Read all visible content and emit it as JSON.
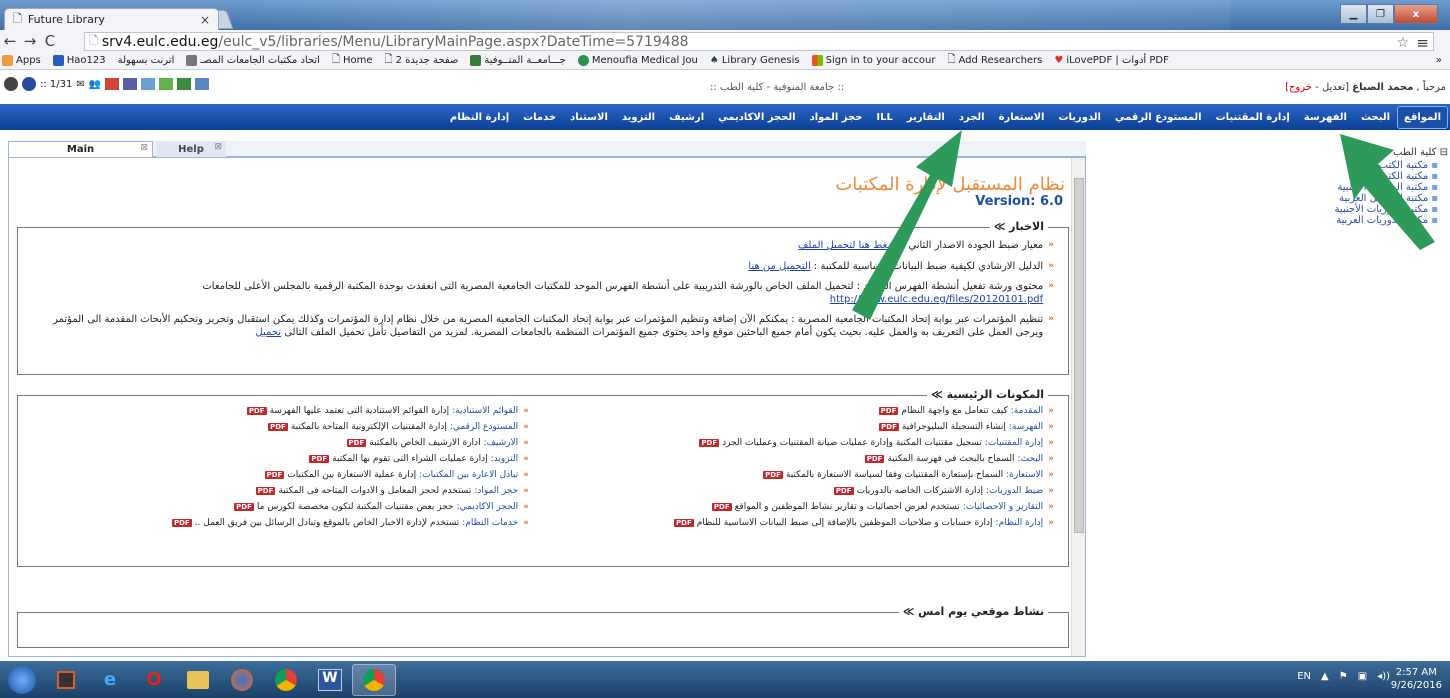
{
  "browser": {
    "tab_title": "Future Library",
    "tab_close": "×",
    "window_buttons": [
      "▁",
      "❐",
      "x"
    ],
    "nav": {
      "back": "←",
      "forward": "→",
      "reload": "C"
    },
    "url_host": "srv4.eulc.edu.eg",
    "url_path": "/eulc_v5/libraries/Menu/LibraryMainPage.aspx?DateTime=5719488",
    "star": "☆",
    "menu": "≡",
    "bookmarks": [
      "Apps",
      "Hao123",
      "اترنت بسهولة",
      "اتحاد مكتبات الجامعات المصـ",
      "Home",
      "صفحة جديدة 2",
      "جـــامعــة المنــوفية",
      "Menoufia Medical Jou",
      "Library Genesis",
      "Sign in to your accour",
      "Add Researchers",
      "iLovePDF | أدوات PDF",
      "»"
    ]
  },
  "status": {
    "left_text": ":: 1/31",
    "flag_colors": [
      "#d0453a",
      "#5c5ca8",
      "#6aa0d8",
      "#64b04a",
      "#3e8a3e",
      "#5a86c4"
    ],
    "center": ":: جامعة المنوفية - كلية الطب ::",
    "greeting": "مرحباً ,",
    "user": "محمد الصباغ",
    "edit": "[تعديل -",
    "logout": "خروج]"
  },
  "mainnav": [
    "المواقع",
    "البحث",
    "الفهرسة",
    "إدارة المقتنيات",
    "المستودع الرقمي",
    "الدوريات",
    "الاستعارة",
    "الجرد",
    "التقارير",
    "ILL",
    "حجز المواد",
    "الحجز الاكاديمي",
    "ارشيف",
    "التزويد",
    "الاستناد",
    "خدمات",
    "إدارة النظام"
  ],
  "panel_tabs": [
    {
      "label": "Main",
      "close": "⊠"
    },
    {
      "label": "Help",
      "close": "⊠"
    }
  ],
  "app_title": "نظام المستقبل لإدارة المكتبات",
  "version": "Version: 6.0",
  "news": {
    "legend": "الاخبار ≫",
    "items": [
      {
        "text": "معيار ضبط الجودة الاصدار الثاني :",
        "link": "اضغط هنا لتحميل الملف"
      },
      {
        "text": "الدليل الارشادي لكيفية ضبط البيانات الأساسية للمكتبة :",
        "link": "التحميل من هنا"
      },
      {
        "text": "محتوى ورشة تفعيل أنشطة الفهرس الموحد : لتحميل الملف الخاص بالورشة التدريبية على أنشطة الفهرس الموحد للمكتبات الجامعية المصرية التى انعقدت بوحدة المكتبة الرقمية بالمجلس الأعلى للجامعات",
        "link": "http://www.eulc.edu.eg/files/20120101.pdf"
      },
      {
        "text": "تنظيم المؤتمرات عبر بوابة إتحاد المكتبات الجامعية المصرية : يمكنكم الآن إضافة وتنظيم المؤتمرات عبر بوابة إتحاد المكتبات الجامعية المصرية من خلال نظام إدارة المؤتمرات وكذلك يمكن استقبال وتحرير وتحكيم الأبحاث المقدمة الى المؤتمر ويرجى العمل على التعريف به والعمل عليه. بحيث يكون أمام جميع الباحثين موقع واحد يحتوى جميع المؤتمرات المنظمة بالجامعات المصرية. لمزيد من التفاصيل تأمل تحميل الملف التالى",
        "link": "تحميل"
      }
    ]
  },
  "components": {
    "legend": "المكونات الرئيسية ≫",
    "pdf": "PDF",
    "items": [
      {
        "t": "المقدمة:",
        "d": "كيف تتعامل مع واجهة النظام"
      },
      {
        "t": "القوائم الاستنادية:",
        "d": "إدارة القوائم الاستنادية التى تعتمد عليها الفهرسة"
      },
      {
        "t": "الفهرسة:",
        "d": "إنشاء التسجيلة الببليوجرافية"
      },
      {
        "t": "المستودع الرقمي:",
        "d": "إدارة المقتنيات الإلكترونية المتاحة بالمكتبة"
      },
      {
        "t": "إدارة المقتنيات:",
        "d": "تسجيل مقتنيات المكتبة وإدارة عمليات صيانة المقتنيات وعمليات الجرد"
      },
      {
        "t": "الأرشيف:",
        "d": "ادارة الارشيف الخاص بالمكتبة"
      },
      {
        "t": "البحث:",
        "d": "السماح بالبحث فى فهرسة المكتبة"
      },
      {
        "t": "التزويد:",
        "d": "إدارة عمليات الشراء التى تقوم بها المكتبة"
      },
      {
        "t": "الاستعارة:",
        "d": "السماح بإستعارة المقتنيات وفقاً لسياسة الاستعارة بالمكتبة"
      },
      {
        "t": "تبادل الاعارة بين المكتبات:",
        "d": "إدارة عملية الاستعارة بين المكتبات"
      },
      {
        "t": "ضبط الدوريات:",
        "d": "إدارة الاشتركات الخاصه بالدوريات"
      },
      {
        "t": "حجز المواد:",
        "d": "تستخدم لحجز المعامل و الأدوات المتاحه فى المكتبة"
      },
      {
        "t": "التقارير و الاحصائيات:",
        "d": "تستخدم لعرض احصائيات و تقارير نشاط الموظفين و المواقع"
      },
      {
        "t": "الحجز الاكاديمي:",
        "d": "حجز بعض مقتنيات المكتبة لتكون مخصصة لكورس ما"
      },
      {
        "t": "إدارة النظام:",
        "d": "إدارة حسابات و صلاحيات الموظفين بالإضافة إلى ضبط البيانات الاساسية للنظام"
      },
      {
        "t": "خدمات النظام:",
        "d": "تستخدم لإدارة الاخبار الخاص بالموقع وتبادل الرسائل بين فريق العمل .."
      }
    ]
  },
  "activity": {
    "legend": "نشاط موقعي يوم امس ≫"
  },
  "tree": {
    "root": "⊟ كلية الطب",
    "items": [
      "مكتبة الكتب الاجنبية",
      "مكتبة الكتب العربية",
      "مكتبة الرسائل الأجنبية",
      "مكتبة الرسائل العربية",
      "مكتبة الدوريات الأجنبية",
      "مكتبة الدوريات العربية"
    ]
  },
  "taskbar": {
    "apps": [
      "start",
      "media",
      "ie",
      "opera",
      "explorer",
      "firefox",
      "chrome-alt",
      "word",
      "chrome"
    ],
    "tray": [
      "EN",
      "▲",
      "⚑",
      "▣",
      "◂))"
    ],
    "time": "2:57 AM",
    "date": "9/26/2016"
  },
  "colors": {
    "nav_bg": "#0b3f96",
    "accent_orange": "#f08a3a",
    "arrow": "#2e9a5a",
    "link": "#1f3fb0"
  }
}
